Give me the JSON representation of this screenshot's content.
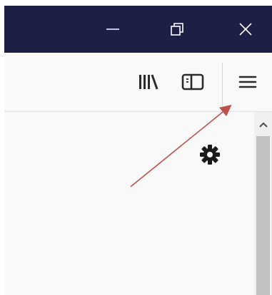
{
  "titlebar": {
    "background": "#1d1f44",
    "minimize_icon": "minimize-icon",
    "restore_icon": "restore-icon",
    "close_icon": "close-icon"
  },
  "toolbar": {
    "background": "#f9f9fa",
    "library_icon": "library-icon",
    "sidebar_icon": "sidebar-icon",
    "menu_icon": "hamburger-menu-icon"
  },
  "content": {
    "gear_icon": "gear-icon"
  },
  "scrollbar": {
    "up_icon": "chevron-up-icon"
  },
  "annotation": {
    "arrow_color": "#c0504d",
    "target": "hamburger-menu-button"
  }
}
